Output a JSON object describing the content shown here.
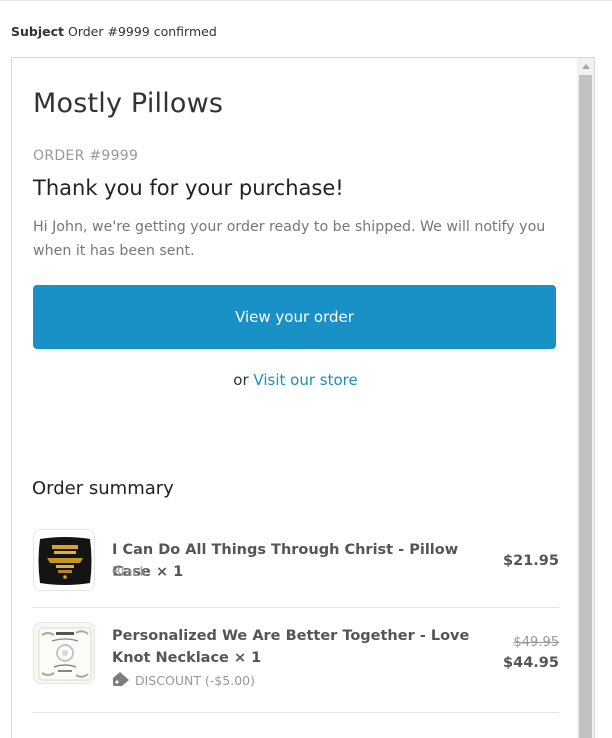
{
  "subject": {
    "label": "Subject",
    "value": "Order #9999 confirmed"
  },
  "email": {
    "shop_name": "Mostly Pillows",
    "order_number": "ORDER #9999",
    "heading": "Thank you for your purchase!",
    "intro": "Hi John, we're getting your order ready to be shipped. We will notify you when it has been sent.",
    "cta_label": "View your order",
    "or_text": "or",
    "store_link": "Visit our store",
    "summary_title": "Order summary",
    "items": [
      {
        "title": "I Can Do All Things Through Christ - Pillow Case × 1",
        "variant": "Black",
        "price": "$21.95",
        "icon": "pillow-thumbnail"
      },
      {
        "title": "Personalized We Are Better Together - Love Knot Necklace × 1",
        "discount": "DISCOUNT (-$5.00)",
        "price_original": "$49.95",
        "price": "$44.95",
        "icon": "necklace-thumbnail"
      }
    ]
  },
  "colors": {
    "accent": "#1990c6",
    "muted": "#999999",
    "text": "#333333"
  }
}
